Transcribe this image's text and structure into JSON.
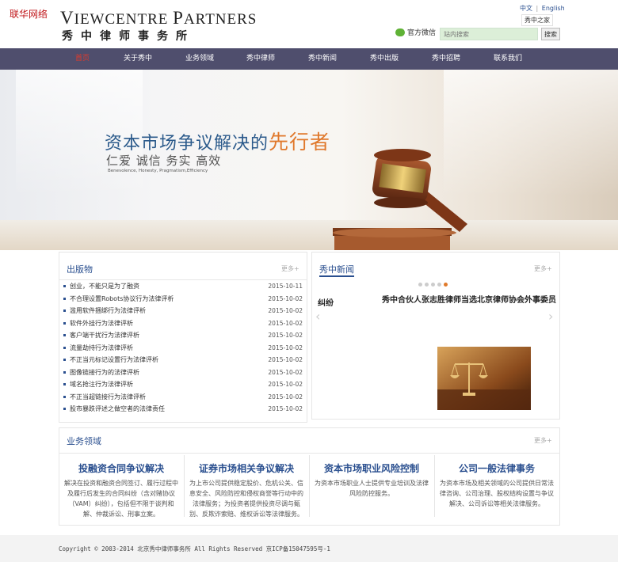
{
  "watermark": "联华网络",
  "logo": {
    "en_first_cap": "V",
    "en_first": "IEWCENTRE ",
    "en_second_cap": "P",
    "en_second": "ARTNERS",
    "cn": "秀中律师事务所"
  },
  "top": {
    "lang_cn": "中文",
    "lang_sep": "|",
    "lang_en": "English",
    "home_link": "秀中之家",
    "wechat": "官方微信",
    "search_placeholder": "站内搜索",
    "search_button": "搜索"
  },
  "nav": [
    "首页",
    "关于秀中",
    "业务领域",
    "秀中律师",
    "秀中新闻",
    "秀中出版",
    "秀中招聘",
    "联系我们"
  ],
  "banner": {
    "title_main": "资本市场争议解决的",
    "title_hl": "先行者",
    "sub": "仁爱 诚信  务实  高效",
    "sub_en": "Benevolence, Honesty, Pragmatism,Efficiency"
  },
  "publications": {
    "title": "出版物",
    "more": "更多+",
    "items": [
      {
        "title": "创业，不能只是为了融资",
        "date": "2015-10-11"
      },
      {
        "title": "不合理设置Robots协议行为法律评析",
        "date": "2015-10-02"
      },
      {
        "title": "滥用软件捆绑行为法律评析",
        "date": "2015-10-02"
      },
      {
        "title": "软件外挂行为法律评析",
        "date": "2015-10-02"
      },
      {
        "title": "客户端干扰行为法律评析",
        "date": "2015-10-02"
      },
      {
        "title": "流量劫持行为法律评析",
        "date": "2015-10-02"
      },
      {
        "title": "不正当元标记设置行为法律评析",
        "date": "2015-10-02"
      },
      {
        "title": "图像链接行为的法律评析",
        "date": "2015-10-02"
      },
      {
        "title": "域名抢注行为法律评析",
        "date": "2015-10-02"
      },
      {
        "title": "不正当超链接行为法律评析",
        "date": "2015-10-02"
      },
      {
        "title": "股市暴跌评述之做空者的法律责任",
        "date": "2015-10-02"
      }
    ]
  },
  "news": {
    "title": "秀中新闻",
    "more": "更多+",
    "slide_left": "纠纷",
    "slide_title": "秀中合伙人张志胜律师当选北京律师协会外事委员"
  },
  "business": {
    "title": "业务领域",
    "more": "更多+",
    "items": [
      {
        "h": "投融资合同争议解决",
        "p": "解决在投资和融资合同签订、履行过程中及履行后发生的合同纠纷（含对赌协议（VAM）纠纷），包括但不限于谈判和解、仲裁诉讼、刑事立案。"
      },
      {
        "h": "证券市场相关争议解决",
        "p": "为上市公司提供稳定股价、危机公关、信息安全、风险防控和侵权商誉等行动中的法律服务；为投资者提供投资尽调与甄别、反欺诈索赔、维权诉讼等法律服务。"
      },
      {
        "h": "资本市场职业风险控制",
        "p": "为资本市场职业人士提供专业培训及法律风险防控服务。"
      },
      {
        "h": "公司一般法律事务",
        "p": "为资本市场及相关领域的公司提供日常法律咨询、公司治理、股权结构设置与争议解决、公司诉讼等相关法律服务。"
      }
    ]
  },
  "footer": "Copyright © 2003-2014 北京秀中律师事务所 All Rights Reserved 京ICP备15047595号-1",
  "colors": {
    "nav_bg": "#4f4e6d",
    "accent": "#2a4f8f",
    "active_nav": "#e03a2a",
    "highlight": "#e0782b"
  }
}
